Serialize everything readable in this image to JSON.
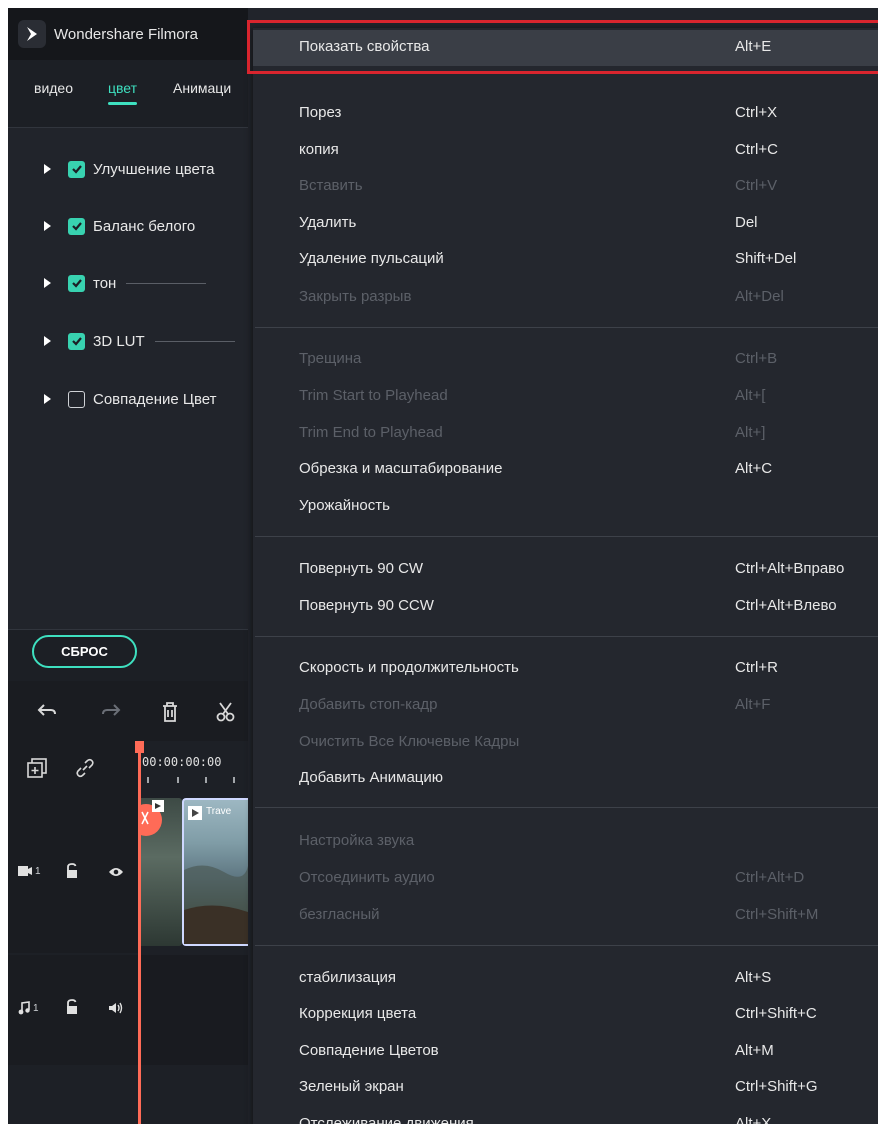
{
  "app": {
    "title": "Wondershare Filmora"
  },
  "tabs": [
    "видео",
    "цвет",
    "Анимаци"
  ],
  "properties": [
    {
      "label": "Улучшение цвета",
      "checked": true
    },
    {
      "label": "Баланс белого",
      "checked": true
    },
    {
      "label": "тон",
      "checked": true
    },
    {
      "label": "3D LUT",
      "checked": true
    },
    {
      "label": "Совпадение Цвет",
      "checked": false
    }
  ],
  "reset_label": "СБРОС",
  "timeline": {
    "timecode": "00:00:00:00",
    "clip_title": "Trave",
    "video_track_number": "1",
    "audio_track_number": "1"
  },
  "colors": {
    "accent": "#3ee0c0",
    "playhead": "#ff6b57",
    "highlight_frame": "#d9252e",
    "menu_bg": "#24272e",
    "disabled_text": "#5c6068"
  },
  "icons": [
    "filmora-logo-icon",
    "undo-icon",
    "redo-icon",
    "delete-icon",
    "scissors-icon",
    "add-track-icon",
    "link-icon",
    "video-track-icon",
    "lock-icon",
    "eye-icon",
    "music-icon",
    "volume-icon"
  ],
  "context_menu": {
    "items": [
      {
        "label": "Показать свойства",
        "shortcut": "Alt+E",
        "enabled": true,
        "highlighted": true
      },
      {
        "label": "Порез",
        "shortcut": "Ctrl+X",
        "enabled": true
      },
      {
        "label": "копия",
        "shortcut": "Ctrl+C",
        "enabled": true
      },
      {
        "label": "Вставить",
        "shortcut": "Ctrl+V",
        "enabled": false
      },
      {
        "label": "Удалить",
        "shortcut": "Del",
        "enabled": true
      },
      {
        "label": "Удаление пульсаций",
        "shortcut": "Shift+Del",
        "enabled": true
      },
      {
        "label": "Закрыть разрыв",
        "shortcut": "Alt+Del",
        "enabled": false
      },
      {
        "label": "Трещина",
        "shortcut": "Ctrl+B",
        "enabled": false
      },
      {
        "label": "Trim Start to Playhead",
        "shortcut": "Alt+[",
        "enabled": false
      },
      {
        "label": "Trim End to Playhead",
        "shortcut": "Alt+]",
        "enabled": false
      },
      {
        "label": "Обрезка и масштабирование",
        "shortcut": "Alt+C",
        "enabled": true
      },
      {
        "label": "Урожайность",
        "shortcut": "",
        "enabled": true
      },
      {
        "label": "Повернуть 90 CW",
        "shortcut": "Ctrl+Alt+Вправо",
        "enabled": true
      },
      {
        "label": "Повернуть 90 CCW",
        "shortcut": "Ctrl+Alt+Влево",
        "enabled": true
      },
      {
        "label": "Скорость и продолжительность",
        "shortcut": "Ctrl+R",
        "enabled": true
      },
      {
        "label": "Добавить стоп-кадр",
        "shortcut": "Alt+F",
        "enabled": false
      },
      {
        "label": "Очистить Все Ключевые Кадры",
        "shortcut": "",
        "enabled": false
      },
      {
        "label": "Добавить Анимацию",
        "shortcut": "",
        "enabled": true
      },
      {
        "label": "Настройка звука",
        "shortcut": "",
        "enabled": false
      },
      {
        "label": "Отсоединить аудио",
        "shortcut": "Ctrl+Alt+D",
        "enabled": false
      },
      {
        "label": "безгласный",
        "shortcut": "Ctrl+Shift+M",
        "enabled": false
      },
      {
        "label": "стабилизация",
        "shortcut": "Alt+S",
        "enabled": true
      },
      {
        "label": "Коррекция цвета",
        "shortcut": "Ctrl+Shift+C",
        "enabled": true
      },
      {
        "label": "Совпадение Цветов",
        "shortcut": "Alt+M",
        "enabled": true
      },
      {
        "label": "Зеленый экран",
        "shortcut": "Ctrl+Shift+G",
        "enabled": true
      },
      {
        "label": "Отслеживание движения",
        "shortcut": "Alt+X",
        "enabled": true
      }
    ]
  }
}
